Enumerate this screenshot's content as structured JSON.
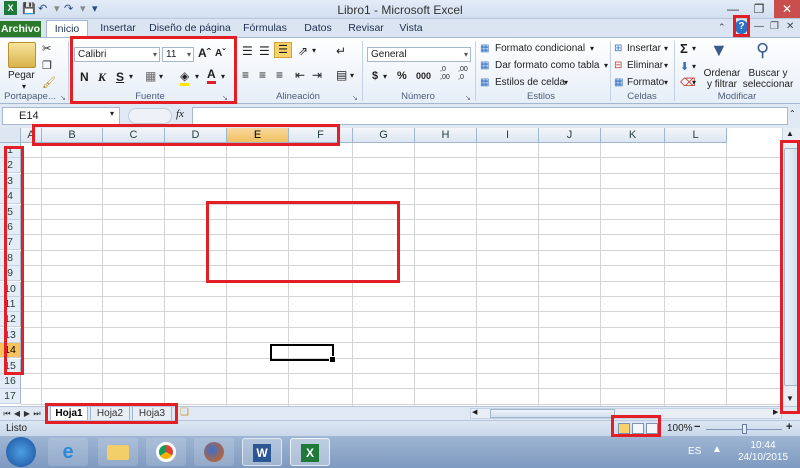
{
  "window": {
    "title": "Libro1 - Microsoft Excel",
    "controls": [
      "minimize",
      "restore",
      "close"
    ]
  },
  "quick_access": {
    "icons": [
      "excel-icon",
      "save-icon",
      "undo-icon",
      "redo-icon",
      "customize-icon"
    ]
  },
  "tabs": [
    {
      "label": "Archivo"
    },
    {
      "label": "Inicio",
      "active": true
    },
    {
      "label": "Insertar"
    },
    {
      "label": "Diseño de página"
    },
    {
      "label": "Fórmulas"
    },
    {
      "label": "Datos"
    },
    {
      "label": "Revisar"
    },
    {
      "label": "Vista"
    }
  ],
  "ribbon": {
    "clipboard": {
      "group": "Portapape...",
      "paste": "Pegar"
    },
    "font": {
      "group": "Fuente",
      "font_name": "Calibri",
      "font_size": "11",
      "bold": "N",
      "italic": "K",
      "underline": "S"
    },
    "alignment": {
      "group": "Alineación"
    },
    "number": {
      "group": "Número",
      "format": "General",
      "currency": "$",
      "percent": "%",
      "thousands": "000",
      "inc_dec": ",0 ,00",
      "dec_dec": ",00 ,0"
    },
    "styles": {
      "group": "Estilos",
      "conditional": "Formato condicional",
      "as_table": "Dar formato como tabla",
      "cell_styles": "Estilos de celda"
    },
    "cells": {
      "group": "Celdas",
      "insert": "Insertar",
      "delete": "Eliminar",
      "format": "Formato"
    },
    "editing": {
      "group": "Modificar",
      "sort_1": "Ordenar",
      "sort_2": "y filtrar",
      "find_1": "Buscar y",
      "find_2": "seleccionar"
    }
  },
  "formula_bar": {
    "name_box": "E14",
    "fx": "fx",
    "formula": ""
  },
  "grid": {
    "columns": [
      "A",
      "B",
      "C",
      "D",
      "E",
      "F",
      "G",
      "H",
      "I",
      "J",
      "K",
      "L"
    ],
    "rows": [
      "1",
      "2",
      "3",
      "4",
      "5",
      "6",
      "7",
      "8",
      "9",
      "10",
      "11",
      "12",
      "13",
      "14",
      "15",
      "16",
      "17"
    ],
    "active_cell": "E14",
    "selected_column": "E",
    "selected_row": "14"
  },
  "sheets": [
    {
      "label": "Hoja1",
      "active": true
    },
    {
      "label": "Hoja2"
    },
    {
      "label": "Hoja3"
    }
  ],
  "status": {
    "text": "Listo",
    "zoom": "100%",
    "zoom_out": "−",
    "zoom_in": "+"
  },
  "taskbar": {
    "apps": [
      "windows-start-icon",
      "internet-explorer-icon",
      "file-explorer-icon",
      "chrome-icon",
      "firefox-icon",
      "word-icon",
      "excel-icon"
    ],
    "language": "ES",
    "time": "10:44",
    "date": "24/10/2015"
  },
  "colors": {
    "annotation_red": "#e31e24",
    "file_tab_green": "#2b7a2b",
    "selected_header": "#f6c25a"
  }
}
